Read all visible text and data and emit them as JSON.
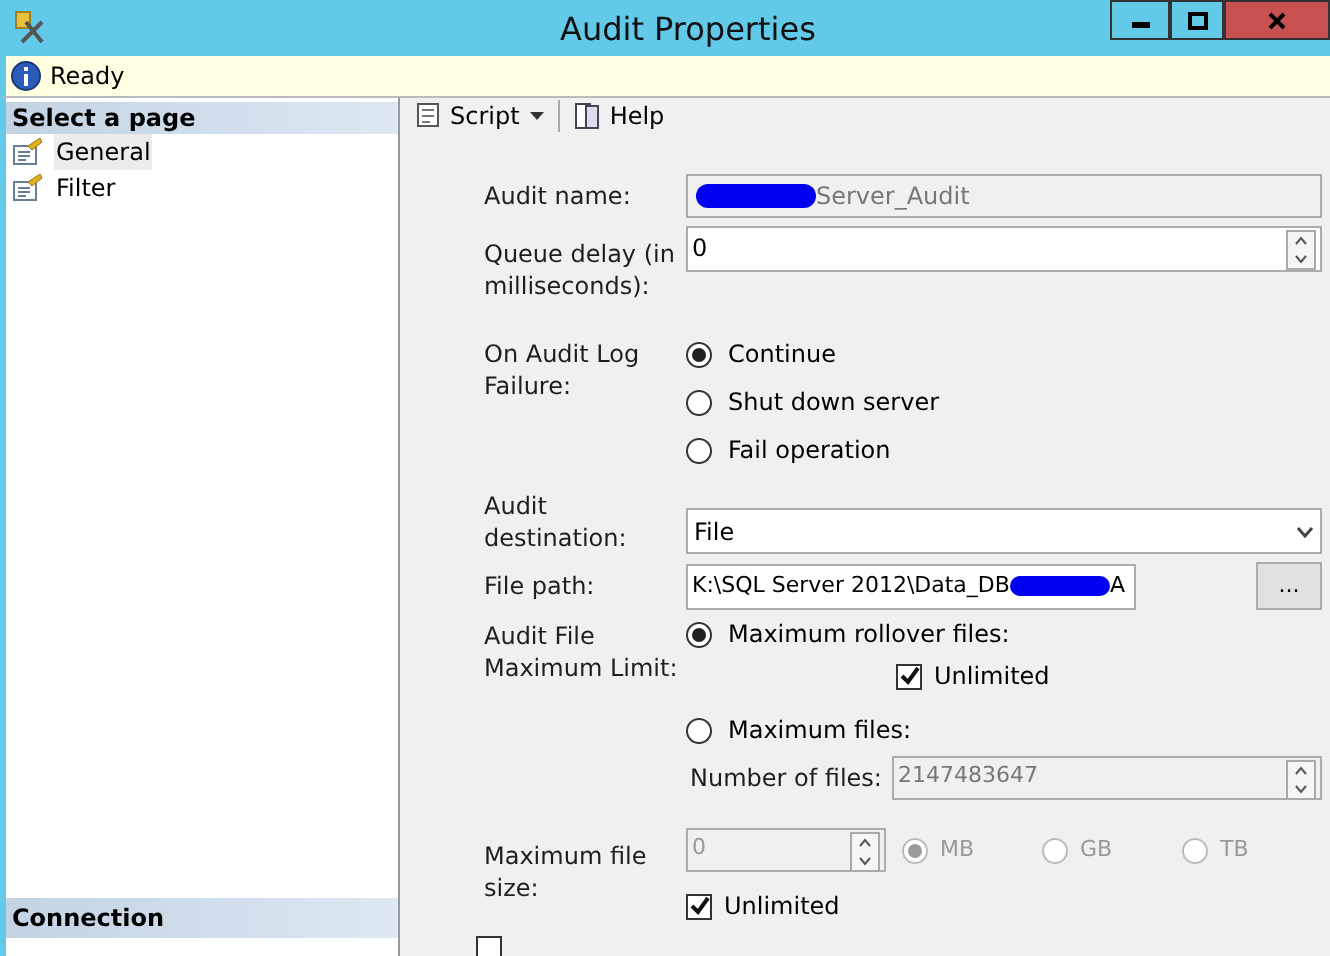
{
  "window": {
    "title": "Audit Properties"
  },
  "status": {
    "text": "Ready"
  },
  "sidebar": {
    "heading": "Select a page",
    "items": [
      {
        "label": "General",
        "selected": true
      },
      {
        "label": "Filter",
        "selected": false
      }
    ],
    "connection_heading": "Connection"
  },
  "toolbar": {
    "script": "Script",
    "help": "Help"
  },
  "form": {
    "audit_name": {
      "label": "Audit name:",
      "value_visible": "Server_Audit",
      "disabled": true
    },
    "queue_delay": {
      "label": "Queue delay (in milliseconds):",
      "value": "0"
    },
    "on_failure": {
      "label": "On Audit Log Failure:",
      "options": [
        {
          "label": "Continue",
          "selected": true
        },
        {
          "label": "Shut down server",
          "selected": false
        },
        {
          "label": "Fail operation",
          "selected": false
        }
      ]
    },
    "destination": {
      "label": "Audit destination:",
      "value": "File"
    },
    "file_path": {
      "label": "File path:",
      "value_start": "K:\\SQL Server 2012\\Data_DB",
      "value_end": "A",
      "browse": "..."
    },
    "max_limit": {
      "label": "Audit File Maximum Limit:",
      "rollover": {
        "label": "Maximum rollover files:",
        "selected": true
      },
      "rollover_unlimited": {
        "label": "Unlimited",
        "checked": true
      },
      "max_files": {
        "label": "Maximum files:",
        "selected": false
      },
      "number_of_files": {
        "label": "Number of files:",
        "value": "2147483647",
        "disabled": true
      }
    },
    "max_file_size": {
      "label": "Maximum file size:",
      "value": "0",
      "disabled": true,
      "units": [
        {
          "label": "MB",
          "selected": true
        },
        {
          "label": "GB",
          "selected": false
        },
        {
          "label": "TB",
          "selected": false
        }
      ],
      "unlimited": {
        "label": "Unlimited",
        "checked": true
      }
    },
    "extra_checkbox": {
      "checked": false
    }
  }
}
